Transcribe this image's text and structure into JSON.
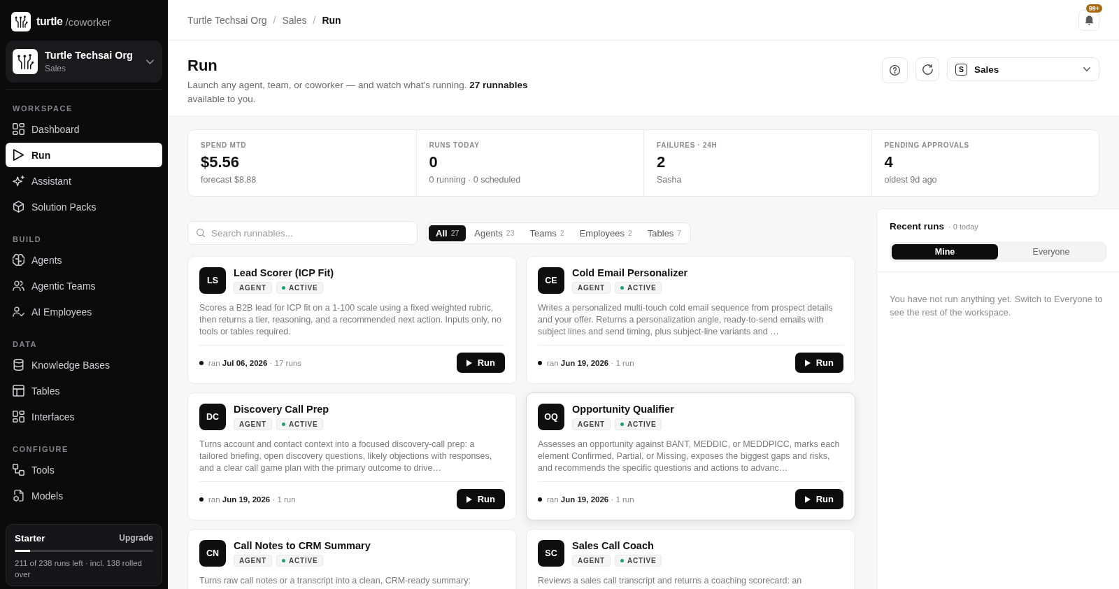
{
  "sidebar": {
    "brand": {
      "name": "turtle",
      "product": "/coworker"
    },
    "org": {
      "name": "Turtle Techsai Org",
      "team": "Sales"
    },
    "sections": [
      {
        "label": "WORKSPACE",
        "items": [
          {
            "label": "Dashboard",
            "selected": false
          },
          {
            "label": "Run",
            "selected": true
          },
          {
            "label": "Assistant",
            "selected": false
          },
          {
            "label": "Solution Packs",
            "selected": false
          }
        ]
      },
      {
        "label": "BUILD",
        "items": [
          {
            "label": "Agents",
            "selected": false
          },
          {
            "label": "Agentic Teams",
            "selected": false
          },
          {
            "label": "AI Employees",
            "selected": false
          }
        ]
      },
      {
        "label": "DATA",
        "items": [
          {
            "label": "Knowledge Bases",
            "selected": false
          },
          {
            "label": "Tables",
            "selected": false
          },
          {
            "label": "Interfaces",
            "selected": false
          }
        ]
      },
      {
        "label": "CONFIGURE",
        "items": [
          {
            "label": "Tools",
            "selected": false
          },
          {
            "label": "Models",
            "selected": false
          }
        ]
      }
    ],
    "plan": {
      "name": "Starter",
      "action": "Upgrade",
      "level": 0.11,
      "usage": "211 of 238 runs left · incl. 138 rolled over"
    }
  },
  "breadcrumb": {
    "separator": "/",
    "items": [
      "Turtle Techsai Org",
      "Sales",
      "Run"
    ]
  },
  "notifications": {
    "badge": "99+"
  },
  "page": {
    "title": "Run",
    "subtitle": "Launch any agent, team, or coworker — and watch what's running. **27 runnables** available to you.",
    "workspace_select": {
      "initial": "S",
      "value": "Sales"
    }
  },
  "stats": [
    {
      "label": "SPEND MTD",
      "value": "$5.56",
      "detail": "forecast $8.88"
    },
    {
      "label": "RUNS TODAY",
      "value": "0",
      "detail": "0 running · 0 scheduled"
    },
    {
      "label": "FAILURES · 24H",
      "value": "2",
      "detail": "Sasha"
    },
    {
      "label": "PENDING APPROVALS",
      "value": "4",
      "detail": "oldest 9d ago"
    }
  ],
  "search": {
    "placeholder": "Search runnables..."
  },
  "filters": [
    {
      "label": "All",
      "count": "27",
      "selected": true
    },
    {
      "label": "Agents",
      "count": "23",
      "selected": false
    },
    {
      "label": "Teams",
      "count": "2",
      "selected": false
    },
    {
      "label": "Employees",
      "count": "2",
      "selected": false
    },
    {
      "label": "Tables",
      "count": "7",
      "selected": false
    }
  ],
  "cards": [
    {
      "initials": "LS",
      "title": "Lead Scorer (ICP Fit)",
      "type": "AGENT",
      "status": "ACTIVE",
      "description": "Scores a B2B lead for ICP fit on a 1-100 scale using a fixed weighted rubric, then returns a tier, reasoning, and a recommended next action. Inputs only, no tools or tables required.",
      "last_run": "ran **Jul 06, 2026** · 17 runs",
      "action": "Run",
      "hovered": false
    },
    {
      "initials": "CE",
      "title": "Cold Email Personalizer",
      "type": "AGENT",
      "status": "ACTIVE",
      "description": "Writes a personalized multi-touch cold email sequence from prospect details and your offer. Returns a personalization angle, ready-to-send emails with subject lines and send timing, plus subject-line variants and …",
      "last_run": "ran **Jun 19, 2026** · 1 run",
      "action": "Run",
      "hovered": false
    },
    {
      "initials": "DC",
      "title": "Discovery Call Prep",
      "type": "AGENT",
      "status": "ACTIVE",
      "description": "Turns account and contact context into a focused discovery-call prep: a tailored briefing, open discovery questions, likely objections with responses, and a clear call game plan with the primary outcome to drive…",
      "last_run": "ran **Jun 19, 2026** · 1 run",
      "action": "Run",
      "hovered": false
    },
    {
      "initials": "OQ",
      "title": "Opportunity Qualifier",
      "type": "AGENT",
      "status": "ACTIVE",
      "description": "Assesses an opportunity against BANT, MEDDIC, or MEDDPICC, marks each element Confirmed, Partial, or Missing, exposes the biggest gaps and risks, and recommends the specific questions and actions to advanc…",
      "last_run": "ran **Jun 19, 2026** · 1 run",
      "action": "Run",
      "hovered": true
    },
    {
      "initials": "CN",
      "title": "Call Notes to CRM Summary",
      "type": "AGENT",
      "status": "ACTIVE",
      "description": "Turns raw call notes or a transcript into a clean, CRM-ready summary:",
      "hovered": false
    },
    {
      "initials": "SC",
      "title": "Sales Call Coach",
      "type": "AGENT",
      "status": "ACTIVE",
      "description": "Reviews a sales call transcript and returns a coaching scorecard: an",
      "hovered": false
    }
  ],
  "recent_runs": {
    "title": "Recent runs",
    "count": "· 0 today",
    "views": [
      {
        "label": "Mine",
        "selected": true
      },
      {
        "label": "Everyone",
        "selected": false
      }
    ],
    "empty_message": "You have not run anything yet. Switch to Everyone to see the rest of the workspace."
  }
}
